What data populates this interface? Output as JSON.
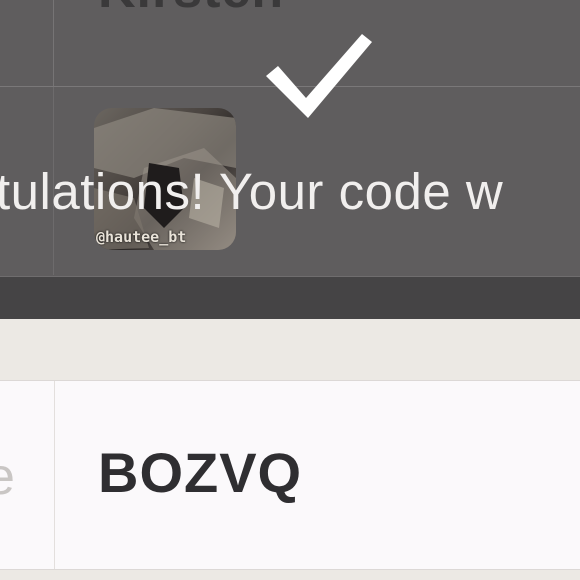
{
  "table": {
    "row1_name": "Kirsten",
    "code_label": "e",
    "code_value": "BOZVQ"
  },
  "overlay": {
    "message": "tulations! Your code w",
    "icon": "checkmark-icon",
    "avatar_handle": "@hautee_bt"
  },
  "colors": {
    "overlay": "#5f5d5e",
    "band": "#454445",
    "code_text": "#2f2e31",
    "box_bg": "#fbf9fb",
    "page_bg": "#ece9e4"
  }
}
